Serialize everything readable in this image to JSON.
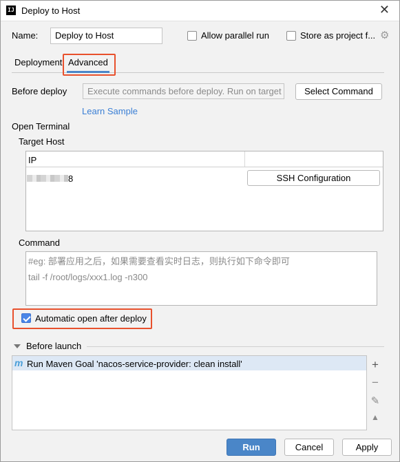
{
  "window": {
    "title": "Deploy to Host",
    "app_icon": "IJ"
  },
  "header": {
    "name_label": "Name:",
    "name_value": "Deploy to Host",
    "allow_parallel_label": "Allow parallel run",
    "store_project_label": "Store as project f..."
  },
  "tabs": [
    {
      "label": "Deployment",
      "selected": false
    },
    {
      "label": "Advanced",
      "selected": true
    }
  ],
  "before_deploy": {
    "label": "Before deploy",
    "placeholder": "Execute commands before deploy. Run on target h",
    "select_command_button": "Select Command",
    "learn_sample_link": "Learn Sample"
  },
  "open_terminal": {
    "label": "Open Terminal",
    "target_host_label": "Target Host",
    "table": {
      "columns": [
        "IP",
        ""
      ],
      "rows": [
        {
          "ip_suffix": "8",
          "action_button": "SSH Configuration"
        }
      ]
    },
    "command_label": "Command",
    "command_line1": "#eg: 部署应用之后，如果需要查看实时日志，则执行如下命令即可",
    "command_line2": "tail -f /root/logs/xxx1.log -n300",
    "auto_open_label": "Automatic open after deploy",
    "auto_open_checked": true
  },
  "before_launch": {
    "label": "Before launch",
    "items": [
      {
        "icon": "maven-icon",
        "text": "Run Maven Goal 'nacos-service-provider: clean install'"
      }
    ]
  },
  "footer": {
    "run": "Run",
    "cancel": "Cancel",
    "apply": "Apply"
  },
  "colors": {
    "accent": "#4a86c8",
    "highlight": "#e8502c",
    "link": "#3a7fd5"
  }
}
